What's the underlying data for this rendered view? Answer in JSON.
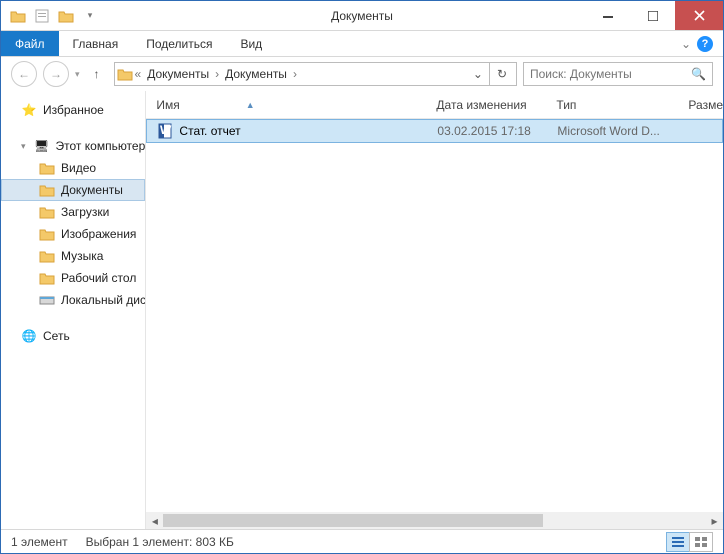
{
  "title": "Документы",
  "ribbon": {
    "file": "Файл",
    "home": "Главная",
    "share": "Поделиться",
    "view": "Вид"
  },
  "breadcrumbs": [
    "Документы",
    "Документы"
  ],
  "search_placeholder": "Поиск: Документы",
  "sidebar": {
    "favorites": "Избранное",
    "this_pc": "Этот компьютер",
    "videos": "Видео",
    "documents": "Документы",
    "downloads": "Загрузки",
    "pictures": "Изображения",
    "music": "Музыка",
    "desktop": "Рабочий стол",
    "local_disk": "Локальный диск (C",
    "network": "Сеть"
  },
  "columns": {
    "name": "Имя",
    "date": "Дата изменения",
    "type": "Тип",
    "size": "Разме"
  },
  "files": [
    {
      "name": "Стат. отчет",
      "date": "03.02.2015 17:18",
      "type": "Microsoft Word D..."
    }
  ],
  "status": {
    "count": "1 элемент",
    "selection": "Выбран 1 элемент: 803 КБ"
  }
}
